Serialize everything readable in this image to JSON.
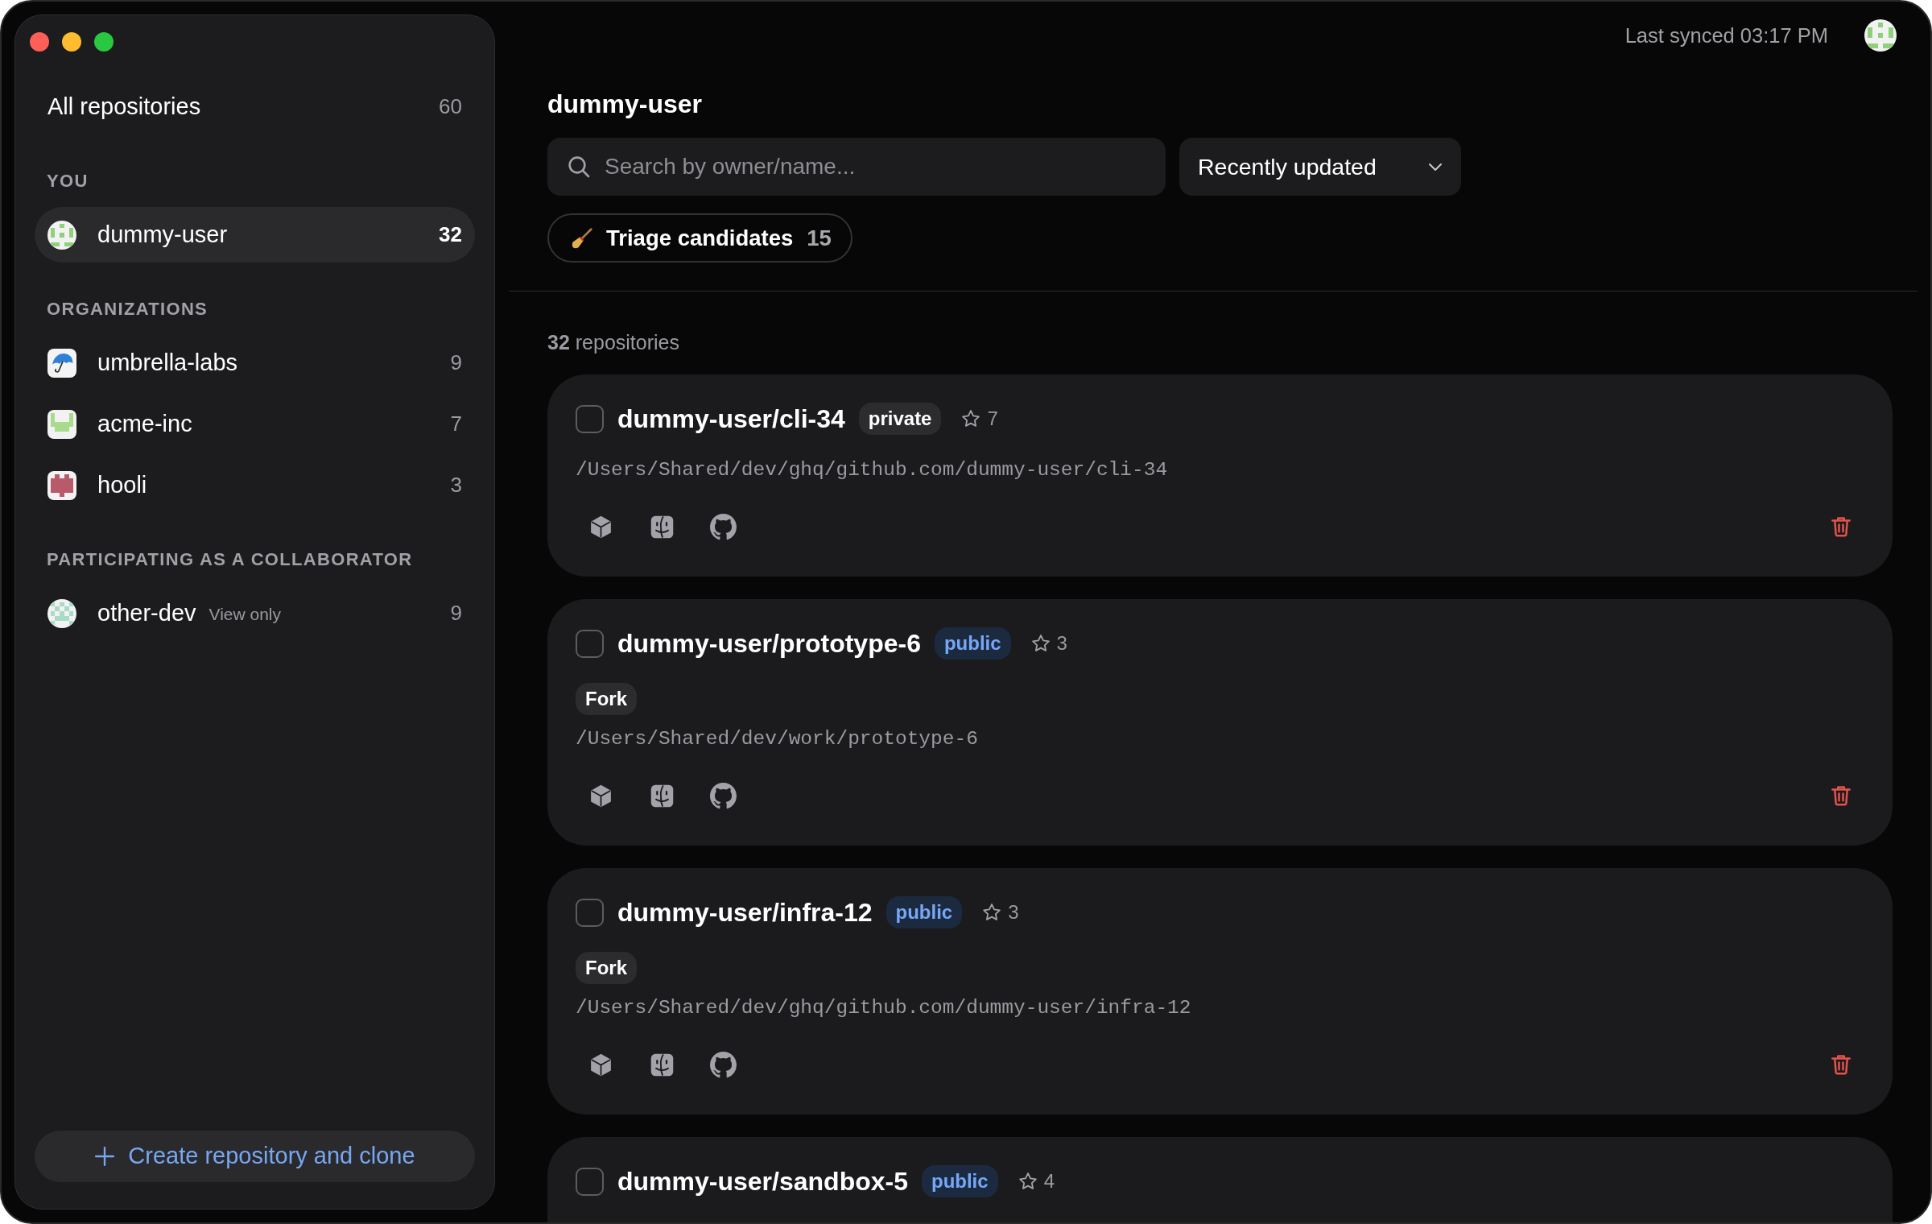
{
  "sidebar": {
    "all_repositories": {
      "label": "All repositories",
      "count": "60",
      "selected": false
    },
    "sections": [
      {
        "heading": "YOU",
        "items": [
          {
            "name": "dummy-user",
            "count": "32",
            "selected": true,
            "avatar": {
              "kind": "identicon",
              "round": true,
              "color": "#8fd17a"
            }
          }
        ]
      },
      {
        "heading": "ORGANIZATIONS",
        "items": [
          {
            "name": "umbrella-labs",
            "count": "9",
            "selected": false,
            "avatar": {
              "kind": "umbrella",
              "round": false
            }
          },
          {
            "name": "acme-inc",
            "count": "7",
            "selected": false,
            "avatar": {
              "kind": "identicon",
              "round": false,
              "color": "#a8dc8c"
            }
          },
          {
            "name": "hooli",
            "count": "3",
            "selected": false,
            "avatar": {
              "kind": "identicon",
              "round": false,
              "color": "#b85a6c"
            }
          }
        ]
      },
      {
        "heading": "PARTICIPATING AS A COLLABORATOR",
        "items": [
          {
            "name": "other-dev",
            "note": "View only",
            "count": "9",
            "selected": false,
            "avatar": {
              "kind": "identicon",
              "round": true,
              "color": "#a9dcc6"
            }
          }
        ]
      }
    ],
    "create_button": {
      "label": "Create repository and clone"
    }
  },
  "header": {
    "sync_status": "Last synced 03:17 PM"
  },
  "owner_title": "dummy-user",
  "search": {
    "placeholder": "Search by owner/name..."
  },
  "sort": {
    "value": "Recently updated"
  },
  "filters": [
    {
      "label": "Triage candidates",
      "count": "15",
      "selected": false
    }
  ],
  "result_count": "**32** repositories",
  "repositories": [
    {
      "name": "dummy-user/cli-34",
      "checked": false,
      "visibility": {
        "label": "private",
        "kind": "private"
      },
      "star_count": "7",
      "path": "/Users/Shared/dev/ghq/github.com/dummy-user/cli-34"
    },
    {
      "name": "dummy-user/prototype-6",
      "checked": false,
      "visibility": {
        "label": "public",
        "kind": "public"
      },
      "star_count": "3",
      "tags": [
        "Fork"
      ],
      "path": "/Users/Shared/dev/work/prototype-6"
    },
    {
      "name": "dummy-user/infra-12",
      "checked": false,
      "visibility": {
        "label": "public",
        "kind": "public"
      },
      "star_count": "3",
      "tags": [
        "Fork"
      ],
      "path": "/Users/Shared/dev/ghq/github.com/dummy-user/infra-12"
    },
    {
      "name": "dummy-user/sandbox-5",
      "checked": false,
      "visibility": {
        "label": "public",
        "kind": "public"
      },
      "star_count": "4"
    }
  ]
}
